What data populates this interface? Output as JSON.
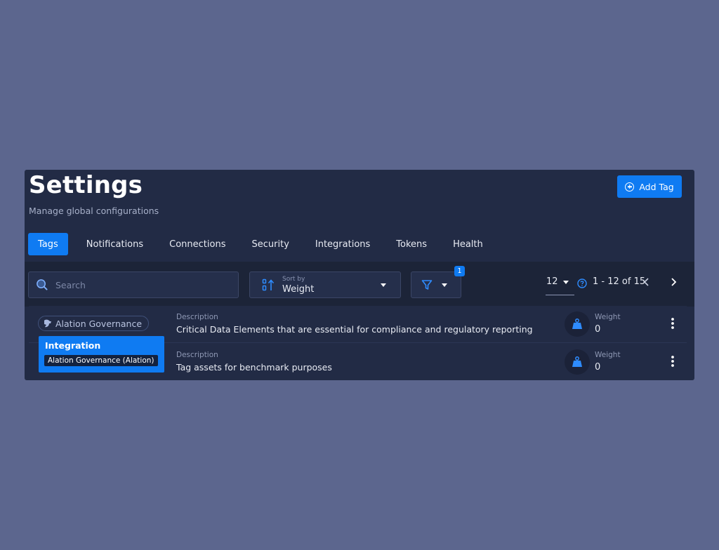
{
  "header": {
    "title": "Settings",
    "subtitle": "Manage global configurations",
    "add_button_label": "Add Tag"
  },
  "tabs": [
    {
      "label": "Tags",
      "active": true
    },
    {
      "label": "Notifications",
      "active": false
    },
    {
      "label": "Connections",
      "active": false
    },
    {
      "label": "Security",
      "active": false
    },
    {
      "label": "Integrations",
      "active": false
    },
    {
      "label": "Tokens",
      "active": false
    },
    {
      "label": "Health",
      "active": false
    }
  ],
  "toolbar": {
    "search_placeholder": "Search",
    "sort_label": "Sort by",
    "sort_value": "Weight",
    "filter_count": "1",
    "per_page": "12",
    "range_text": "1 - 12 of 15"
  },
  "rows": [
    {
      "chip_label": "Alation Governance",
      "description_label": "Description",
      "description": "Critical Data Elements that are essential for compliance and regulatory reporting",
      "weight_label": "Weight",
      "weight_value": "0"
    },
    {
      "description_label": "Description",
      "description": "Tag assets for benchmark purposes",
      "weight_label": "Weight",
      "weight_value": "0"
    }
  ],
  "tooltip": {
    "title": "Integration",
    "subtitle": "Alation Governance (Alation)"
  },
  "colors": {
    "page_background": "#5c668e",
    "panel": "#222b45",
    "accent": "#0f7bf2"
  },
  "icons": [
    "plus-circle-icon",
    "search-icon",
    "sort-icon",
    "filter-icon",
    "chevron-down-icon",
    "help-icon",
    "chevron-left-icon",
    "chevron-right-icon",
    "weight-icon",
    "kebab-menu-icon",
    "integration-icon"
  ]
}
